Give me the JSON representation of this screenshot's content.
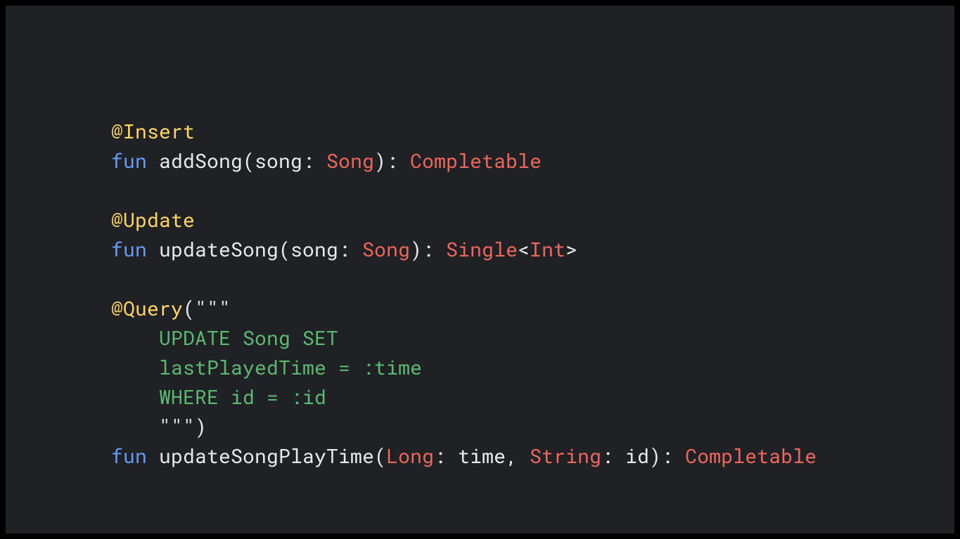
{
  "code": {
    "line1": {
      "anno": "@Insert"
    },
    "line2": {
      "kw": "fun",
      "name": " addSong(song",
      "colon1": ": ",
      "type1": "Song",
      "ret": "): ",
      "type2": "Completable"
    },
    "line3": "",
    "line4": {
      "anno": "@Update"
    },
    "line5": {
      "kw": "fun",
      "name": " updateSong(song",
      "colon1": ": ",
      "type1": "Song",
      "ret": "): ",
      "type2": "Single",
      "lt": "<",
      "type3": "Int",
      "gt": ">"
    },
    "line6": "",
    "line7": {
      "anno": "@Query",
      "paren": "(",
      "q": "\"\"\""
    },
    "line8": {
      "str": "    UPDATE Song SET"
    },
    "line9": {
      "str": "    lastPlayedTime = :time"
    },
    "line10": {
      "str": "    WHERE id = :id"
    },
    "line11": {
      "str": "    ",
      "q": "\"\"\"",
      "paren": ")"
    },
    "line12": {
      "kw": "fun",
      "name": " updateSongPlayTime(",
      "type1": "Long",
      "mid1": ": time, ",
      "type2": "String",
      "mid2": ": id): ",
      "type3": "Completable"
    }
  }
}
